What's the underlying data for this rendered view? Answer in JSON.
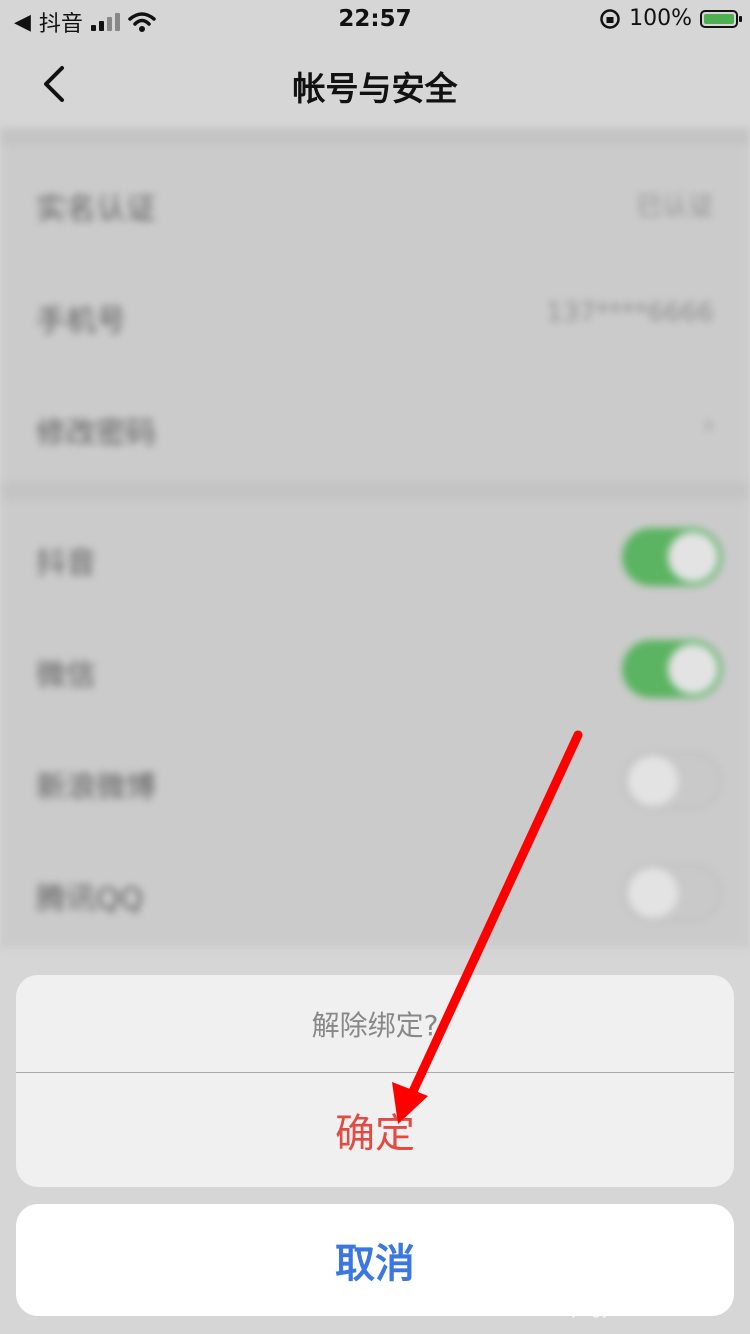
{
  "status_bar": {
    "app_back": "抖音",
    "time": "22:57",
    "battery_percent": "100%"
  },
  "nav": {
    "title": "帐号与安全"
  },
  "background_list": {
    "section1": [
      {
        "label": "实名认证",
        "value": "已认证"
      },
      {
        "label": "手机号",
        "value": "137****6666"
      },
      {
        "label": "修改密码",
        "value": ""
      }
    ],
    "section2": [
      {
        "label": "抖音",
        "toggle": true
      },
      {
        "label": "微信",
        "toggle": true
      },
      {
        "label": "新浪微博",
        "toggle": false
      },
      {
        "label": "腾讯QQ",
        "toggle": false
      }
    ]
  },
  "action_sheet": {
    "message": "解除绑定?",
    "confirm_label": "确定",
    "cancel_label": "取消"
  },
  "watermark": {
    "main": "Bai 经验",
    "sub": "jingyan.baidu.com"
  },
  "colors": {
    "confirm": "#e04c43",
    "cancel": "#3a77e0",
    "toggle_on": "#5bb462",
    "annotation_arrow": "#ff0000"
  }
}
